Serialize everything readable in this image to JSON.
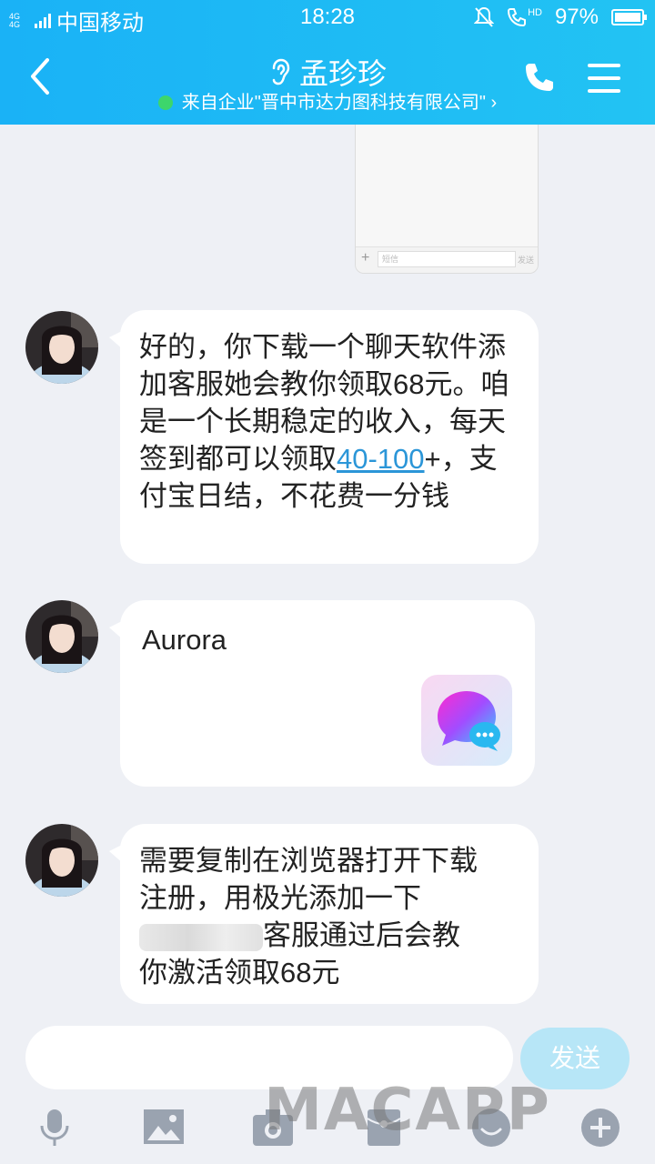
{
  "status_bar": {
    "network_tag": "4G 4G",
    "carrier": "中国移动",
    "time": "18:28",
    "hd_label": "HD",
    "battery": "97%"
  },
  "header": {
    "title": "孟珍珍",
    "subtitle": "来自企业\"晋中市达力图科技有限公司\" ›"
  },
  "card_top": {
    "plus": "+",
    "input_placeholder": "短信",
    "send": "发送"
  },
  "messages": [
    {
      "part1": "好的，你下载一个聊天软件添加客服她会教你领取68元。咱是一个长期稳定的收入，每天签到都可以领取",
      "link": "40-100",
      "part2": "+，支付宝日结，不花费一分钱"
    },
    {
      "app_name": "Aurora"
    },
    {
      "part1": "需要复制在浏览器打开下载注册，用极光添加一下",
      "part2": "客服通过后会教你激活领取68元"
    }
  ],
  "input": {
    "send_label": "发送"
  },
  "watermark": "MACAPP",
  "colors": {
    "header_start": "#1ab2f6",
    "header_end": "#22c3f3",
    "background": "#eef0f5",
    "link": "#2b96d8",
    "send_button": "#b7e6f7"
  }
}
